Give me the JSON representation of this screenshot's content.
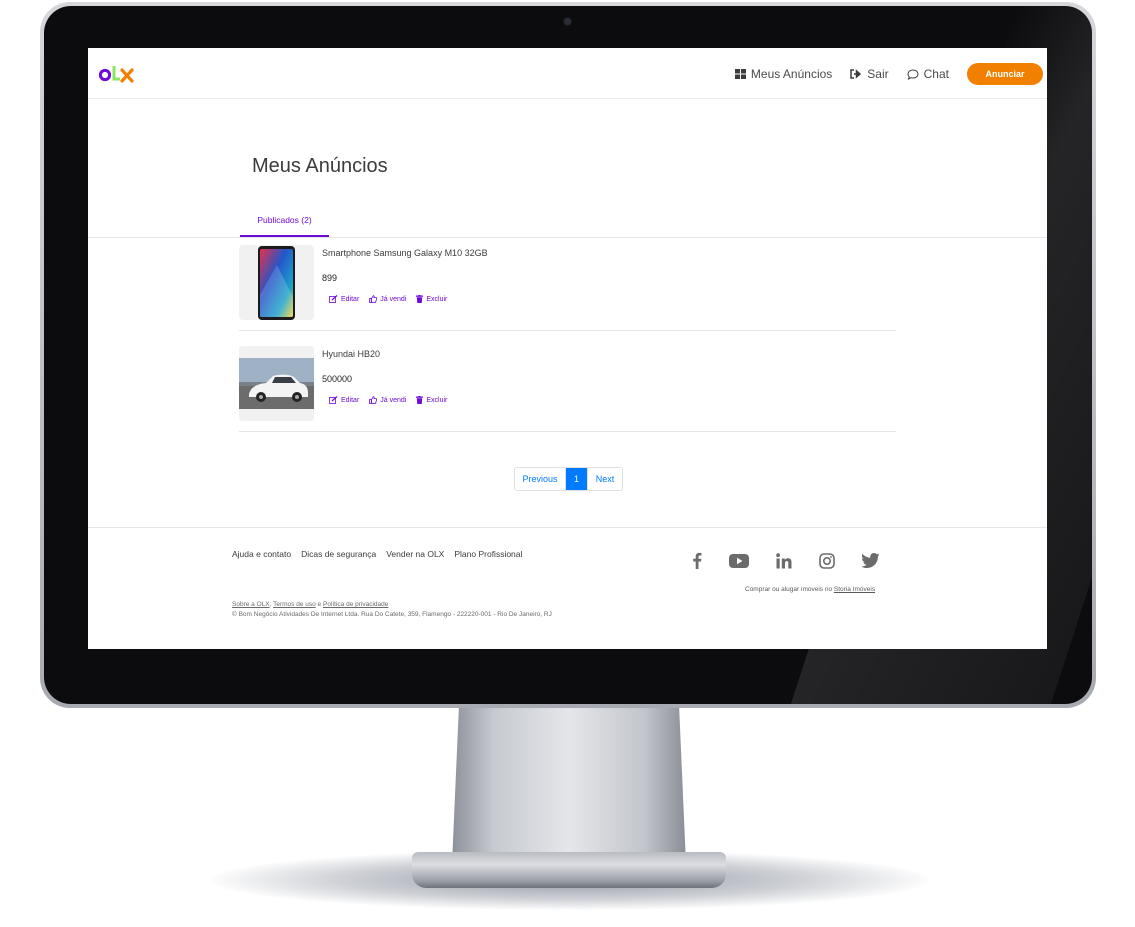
{
  "header": {
    "nav": {
      "meus_anuncios": "Meus Anúncios",
      "sair": "Sair",
      "chat": "Chat",
      "anunciar": "Anunciar"
    }
  },
  "main": {
    "title": "Meus Anúncios",
    "tabs": [
      {
        "label": "Publicados (2)"
      }
    ],
    "ads": [
      {
        "title": "Smartphone Samsung Galaxy M10 32GB",
        "price": "899"
      },
      {
        "title": "Hyundai HB20",
        "price": "500000"
      }
    ],
    "actions": {
      "edit": "Editar",
      "sold": "Já vendi",
      "delete": "Excluir"
    },
    "pagination": {
      "previous": "Previous",
      "current": "1",
      "next": "Next"
    }
  },
  "footer": {
    "links": [
      "Ajuda e contato",
      "Dicas de segurança",
      "Vender na OLX",
      "Plano Profissional"
    ],
    "note_text": "Comprar ou alugar imoveis no",
    "note_link": "Storia Imóveis",
    "legal": {
      "sobre": "Sobre a OLX",
      "comma": ",",
      "termos": "Termos de uso",
      "e": "e",
      "politica": "Política de privacidade",
      "copyright": "© Bom Negócio Atividades De Internet Ltda. Rua Do Catete, 359, Flamengo - 222220-001 - Rio De Janeiro, RJ"
    }
  },
  "colors": {
    "purple": "#6e0ad6",
    "orange": "#f28000",
    "green": "#8ce563",
    "primary_blue": "#007bff"
  },
  "icons": [
    "olx-logo",
    "grid-icon",
    "sign-out-icon",
    "chat-bubble-icon",
    "edit-icon",
    "thumbs-up-icon",
    "trash-icon",
    "facebook-icon",
    "youtube-icon",
    "linkedin-icon",
    "instagram-icon",
    "twitter-icon"
  ]
}
